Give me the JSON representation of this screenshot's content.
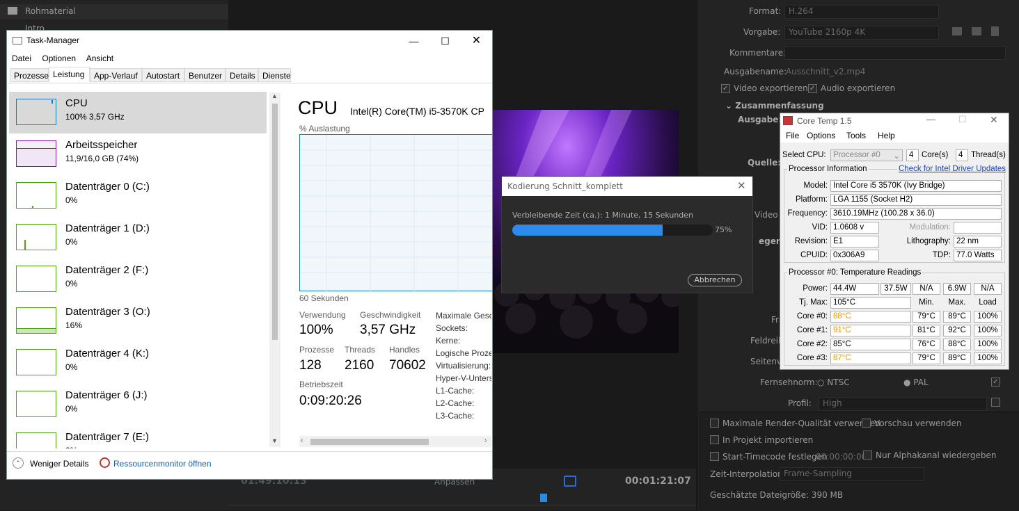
{
  "premiere": {
    "project": {
      "folder1": "Rohmaterial",
      "folder2": "Intro"
    },
    "timecode_left": "01:49:10:13",
    "timecode_right": "00:01:21:07",
    "fit_label": "Anpassen",
    "export": {
      "format_label": "Format:",
      "format_value": "H.264",
      "preset_label": "Vorgabe:",
      "preset_value": "YouTube 2160p 4K",
      "comment_label": "Kommentare:",
      "output_name_label": "Ausgabename:",
      "output_name_value": "Ausschnitt_v2.mp4",
      "export_video": "Video exportieren",
      "export_audio": "Audio exportieren",
      "summary_label": "Zusammenfassung",
      "output_label": "Ausgabe:",
      "source_label": "Quelle:",
      "video_tab": "Video",
      "legend_partial": "egende",
      "frame_partial": "Fra",
      "field_order_partial": "Feldreih",
      "aspect_partial": "Seitenve",
      "tv_standard_label": "Fernsehnorm:",
      "ntsc": "NTSC",
      "pal": "PAL",
      "profile_label": "Profil:",
      "profile_value": "High",
      "max_render": "Maximale Render-Qualität verwenden",
      "use_preview": "Vorschau verwenden",
      "import_project": "In Projekt importieren",
      "set_start_tc": "Start-Timecode festlegen",
      "start_tc_value": "00:00:00:00",
      "alpha_only": "Nur Alphakanal wiedergeben",
      "time_interp_label": "Zeit-Interpolation:",
      "time_interp_value": "Frame-Sampling",
      "est_size": "Geschätzte Dateigröße:  390 MB"
    }
  },
  "task_manager": {
    "title": "Task-Manager",
    "menu": [
      "Datei",
      "Optionen",
      "Ansicht"
    ],
    "tabs": [
      "Prozesse",
      "Leistung",
      "App-Verlauf",
      "Autostart",
      "Benutzer",
      "Details",
      "Dienste"
    ],
    "sidebar": [
      {
        "name": "CPU",
        "value": "100% 3,57 GHz"
      },
      {
        "name": "Arbeitsspeicher",
        "value": "11,9/16,0 GB (74%)"
      },
      {
        "name": "Datenträger 0 (C:)",
        "value": "0%"
      },
      {
        "name": "Datenträger 1 (D:)",
        "value": "0%"
      },
      {
        "name": "Datenträger 2 (F:)",
        "value": "0%"
      },
      {
        "name": "Datenträger 3 (O:)",
        "value": "16%"
      },
      {
        "name": "Datenträger 4 (K:)",
        "value": "0%"
      },
      {
        "name": "Datenträger 6 (J:)",
        "value": "0%"
      },
      {
        "name": "Datenträger 7 (E:)",
        "value": "0%"
      }
    ],
    "detail": {
      "heading": "CPU",
      "model": "Intel(R) Core(TM) i5-3570K CP",
      "graph_label": "% Auslastung",
      "time_label": "60 Sekunden",
      "usage_label": "Verwendung",
      "usage_value": "100%",
      "speed_label": "Geschwindigkeit",
      "speed_value": "3,57 GHz",
      "processes_label": "Prozesse",
      "processes_value": "128",
      "threads_label": "Threads",
      "threads_value": "2160",
      "handles_label": "Handles",
      "handles_value": "70602",
      "uptime_label": "Betriebszeit",
      "uptime_value": "0:09:20:26",
      "right_labels": [
        "Maximale Gesch",
        "Sockets:",
        "Kerne:",
        "Logische Prozes",
        "Virtualisierung:",
        "Hyper-V-Unters",
        "L1-Cache:",
        "L2-Cache:",
        "L3-Cache:"
      ]
    },
    "footer": {
      "fewer_details": "Weniger Details",
      "resource_monitor": "Ressourcenmonitor öffnen"
    }
  },
  "encoding_dialog": {
    "title": "Kodierung Schnitt_komplett",
    "remaining": "Verbleibende Zeit (ca.): 1 Minute, 15 Sekunden",
    "progress": 75,
    "progress_label": "75%",
    "cancel": "Abbrechen"
  },
  "core_temp": {
    "title": "Core Temp 1.5",
    "menu": [
      "File",
      "Options",
      "Tools",
      "Help"
    ],
    "select_cpu_label": "Select CPU:",
    "select_cpu_value": "Processor #0",
    "cores_value": "4",
    "cores_label": "Core(s)",
    "threads_value": "4",
    "threads_label": "Thread(s)",
    "proc_info_label": "Processor Information",
    "driver_link": "Check for Intel Driver Updates",
    "model_label": "Model:",
    "model_value": "Intel Core i5 3570K (Ivy Bridge)",
    "platform_label": "Platform:",
    "platform_value": "LGA 1155 (Socket H2)",
    "frequency_label": "Frequency:",
    "frequency_value": "3610.19MHz (100.28 x 36.0)",
    "vid_label": "VID:",
    "vid_value": "1.0608 v",
    "modulation_label": "Modulation:",
    "revision_label": "Revision:",
    "revision_value": "E1",
    "lithography_label": "Lithography:",
    "lithography_value": "22 nm",
    "cpuid_label": "CPUID:",
    "cpuid_value": "0x306A9",
    "tdp_label": "TDP:",
    "tdp_value": "77.0 Watts",
    "temp_label": "Processor #0: Temperature Readings",
    "power_label": "Power:",
    "power_values": [
      "44.4W",
      "37.5W",
      "N/A",
      "6.9W",
      "N/A"
    ],
    "tjmax_label": "Tj. Max:",
    "tjmax_value": "105°C",
    "col_min": "Min.",
    "col_max": "Max.",
    "col_load": "Load",
    "cores": [
      {
        "label": "Core #0:",
        "temp": "88°C",
        "min": "79°C",
        "max": "89°C",
        "load": "100%"
      },
      {
        "label": "Core #1:",
        "temp": "91°C",
        "min": "81°C",
        "max": "92°C",
        "load": "100%"
      },
      {
        "label": "Core #2:",
        "temp": "85°C",
        "min": "76°C",
        "max": "88°C",
        "load": "100%"
      },
      {
        "label": "Core #3:",
        "temp": "87°C",
        "min": "79°C",
        "max": "89°C",
        "load": "100%"
      }
    ]
  }
}
